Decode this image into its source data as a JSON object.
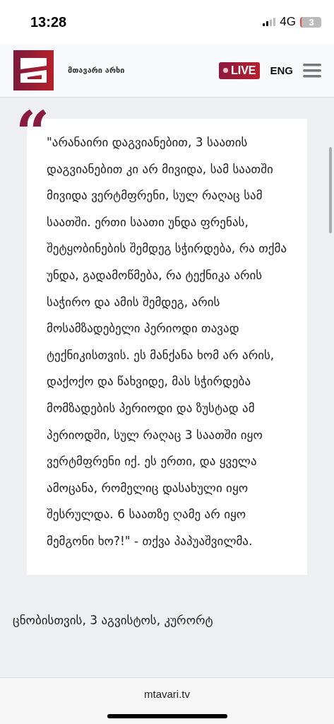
{
  "status_bar": {
    "time": "13:28",
    "network": "4G",
    "battery": "3"
  },
  "header": {
    "logo_text": "მთავარი არხი",
    "live": "LIVE",
    "language": "ENG"
  },
  "quote": {
    "mark": "“",
    "text": "\"არანაირი დაგვიანებით, 3 საათის დაგვიანებით კი არ მივიდა, სამ საათში მივიდა ვერტმფრენი, სულ რაღაც სამ საათში. ერთი საათი უნდა ფრენას, შეტყობინების შემდეგ სჭირდება, რა თქმა უნდა, გადამოწმება, რა ტექნიკა არის საჭირო და ამის შემდეგ, არის მოსამზადებელი პერიოდი თავად ტექნიკისთვის. ეს მანქანა ხომ არ არის, დაქოქო და წახვიდე, მას სჭირდება მომზადების პერიოდი და ზუსტად ამ პერიოდში, სულ რაღაც 3 საათში იყო ვერტმფრენი იქ. ეს ერთი, და ყველა ამოცანა, რომელიც დასახული იყო შესრულდა. 6 საათზე ღამე არ იყო მემგონი ხო?!\" - თქვა პაპუაშვილმა."
  },
  "next_paragraph": "ცნობისთვის, 3 აგვისტოს, კურორტ",
  "address_bar": {
    "url": "mtavari.tv"
  }
}
